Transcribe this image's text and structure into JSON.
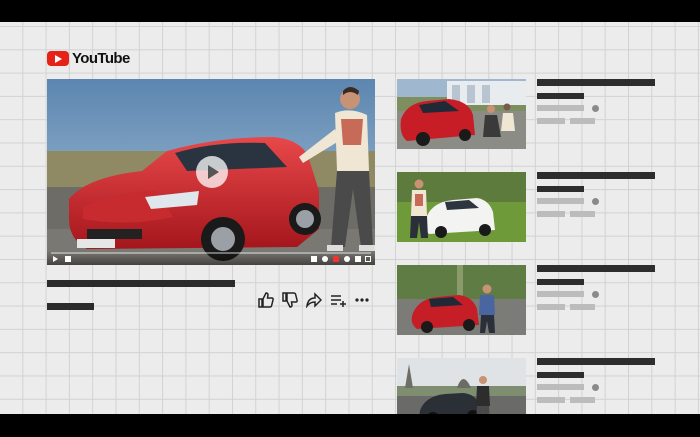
{
  "app": {
    "brand": "YouTube",
    "brand_color": "#e62117"
  },
  "player": {
    "state": "paused",
    "progress_fraction": 0.0,
    "icons": [
      "play-icon",
      "volume-icon",
      "subtitles-icon",
      "settings-icon",
      "miniplayer-icon",
      "theater-icon",
      "fullscreen-icon"
    ]
  },
  "actions": {
    "icons": [
      "like-icon",
      "dislike-icon",
      "share-icon",
      "save-icon",
      "more-icon"
    ]
  },
  "recommendations": [
    {
      "thumbnail": "red-hatchback-two-people",
      "verified": true
    },
    {
      "thumbnail": "white-suv-man-standing",
      "verified": true
    },
    {
      "thumbnail": "red-hatchback-man-trees",
      "verified": true
    },
    {
      "thumbnail": "dark-hatchback-man-sky",
      "verified": true
    }
  ]
}
